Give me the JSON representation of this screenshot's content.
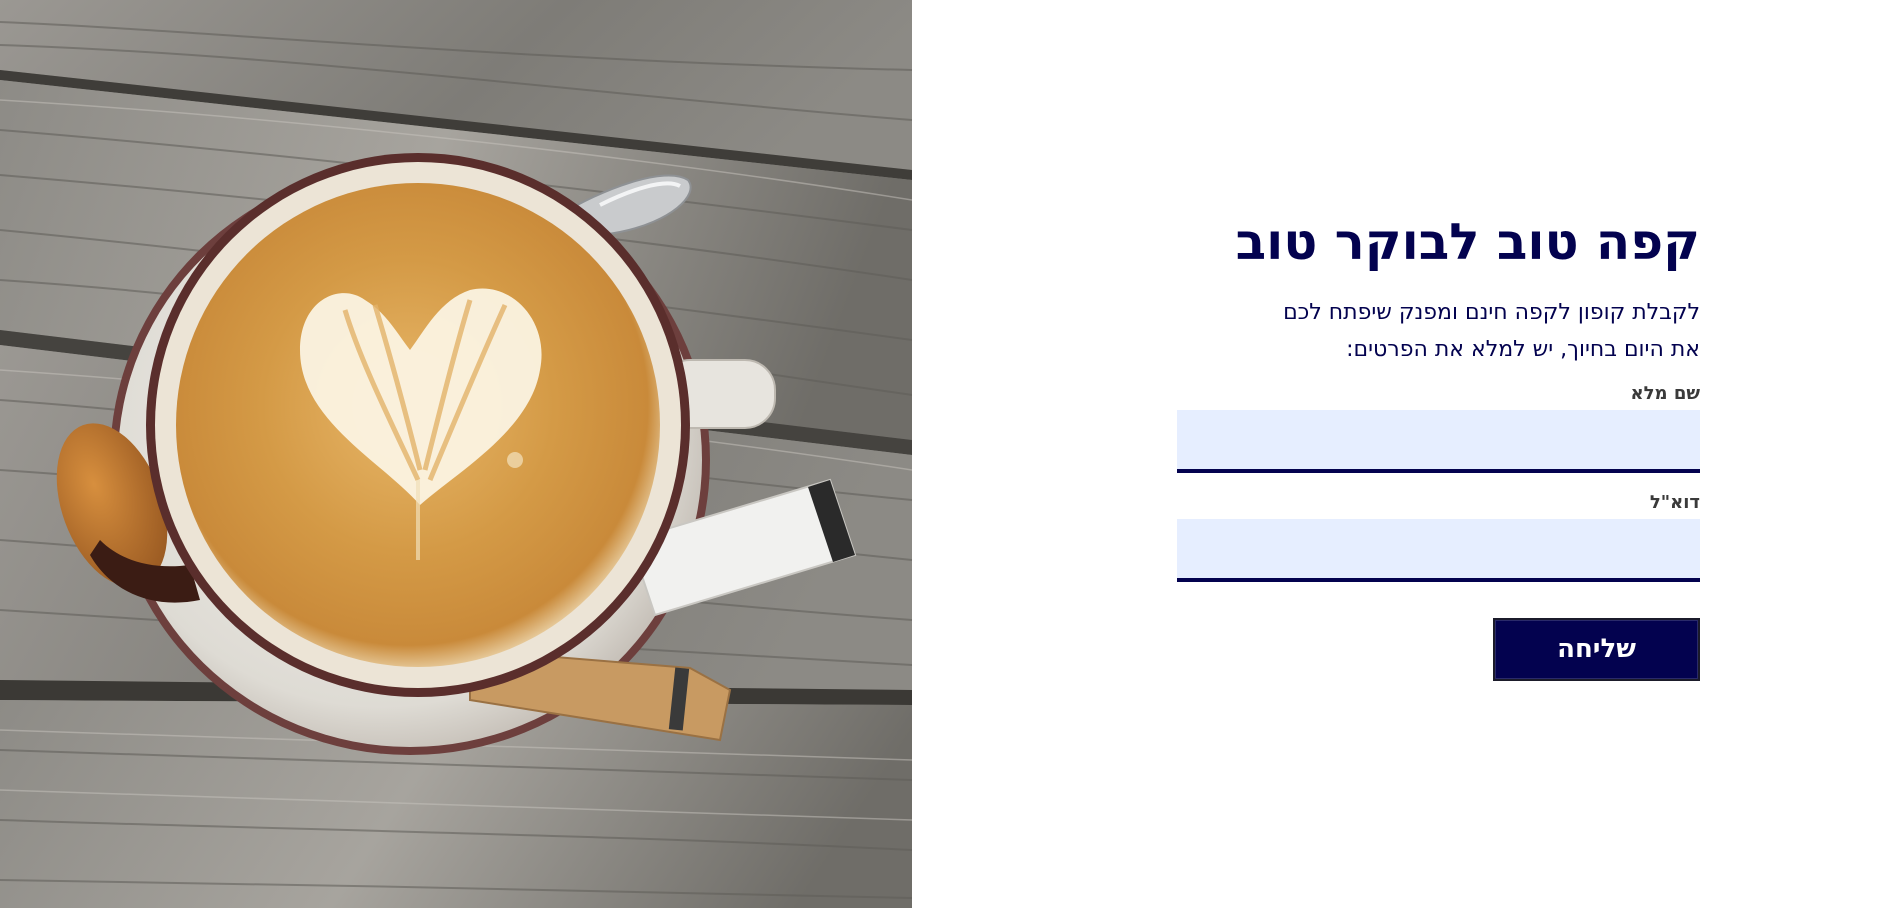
{
  "hero": {
    "image_alt": "Latte art coffee cup with biscotti on wooden table"
  },
  "form": {
    "title": "קפה טוב לבוקר טוב",
    "intro_line_1": "לקבלת קופון לקפה חינם ומפנק שיפתח לכם",
    "intro_line_2": "את היום בחיוך, יש למלא את הפרטים:",
    "full_name": {
      "label": "שם מלא",
      "value": "",
      "placeholder": ""
    },
    "email": {
      "label": "דוא\"ל",
      "value": "",
      "placeholder": ""
    },
    "submit_label": "שליחה"
  },
  "colors": {
    "brand_navy": "#03024f",
    "input_background": "#e6eeff",
    "label_gray": "#3a3a3a",
    "page_background": "#ffffff"
  }
}
